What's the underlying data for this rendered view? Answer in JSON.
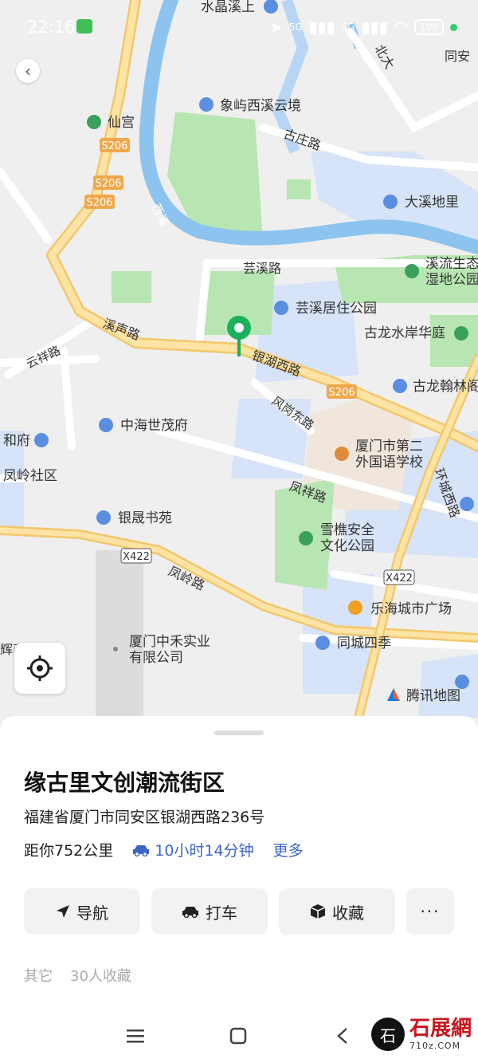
{
  "status_bar": {
    "time": "22:16",
    "network_1": "5G",
    "network_2": "5G",
    "battery": "100"
  },
  "map": {
    "labels": {
      "shuijingxi": "水晶溪上",
      "tongan": "同安",
      "beida": "北大",
      "nandao": "路",
      "xianggong": "仙宫",
      "xiangyu": "象屿西溪云境",
      "guzhuang": "古庄路",
      "daxi": "大溪地里",
      "xixi": "西溪",
      "yunxi": "芸溪路",
      "xiliu_1": "溪流生态",
      "xiliu_2": "湿地公园",
      "yunxi_park": "芸溪居住公园",
      "gulong_shui": "古龙水岸华庭",
      "xisheng": "溪声路",
      "yinhu": "银湖西路",
      "gulong_han": "古龙翰林阁",
      "yunxiang": "云祥路",
      "zhonghai": "中海世茂府",
      "fenggang": "风岗东路",
      "hefu": "和府",
      "fengling_sq": "凤岭社区",
      "school_1": "厦门市第二",
      "school_2": "外国语学校",
      "fengxiang": "凤祥路",
      "huancheng": "环城西路",
      "yinsheng": "银晟书苑",
      "xueqiao_1": "雪樵安全",
      "xueqiao_2": "文化公园",
      "fengling_rd": "凤岭路",
      "lehai": "乐海城市广场",
      "zhonghe_1": "厦门中禾实业",
      "zhonghe_2": "有限公司",
      "tongcheng": "同城四季",
      "huishang": "辉商城",
      "tencent_map": "腾讯地图"
    },
    "shields": {
      "s206_a": "S206",
      "s206_b": "S206",
      "s206_c": "S206",
      "s206_d": "S206",
      "x422_a": "X422",
      "x422_b": "X422"
    }
  },
  "sheet": {
    "title": "缘古里文创潮流街区",
    "address": "福建省厦门市同安区银湖西路236号",
    "distance": "距你752公里",
    "drive_time": "10小时14分钟",
    "more": "更多",
    "actions": {
      "navigate": "导航",
      "taxi": "打车",
      "favorite": "收藏",
      "more": "···"
    },
    "meta": {
      "category": "其它",
      "favorites": "30人收藏"
    }
  },
  "brand": {
    "name": "石展網",
    "url": "710z.COM",
    "glyph": "石"
  },
  "colors": {
    "water": "#8cc4ef",
    "green": "#a9e4a4",
    "road": "#ffffff",
    "highway": "#f8d683",
    "pin": "#1ab05c",
    "link": "#3a66c8"
  }
}
